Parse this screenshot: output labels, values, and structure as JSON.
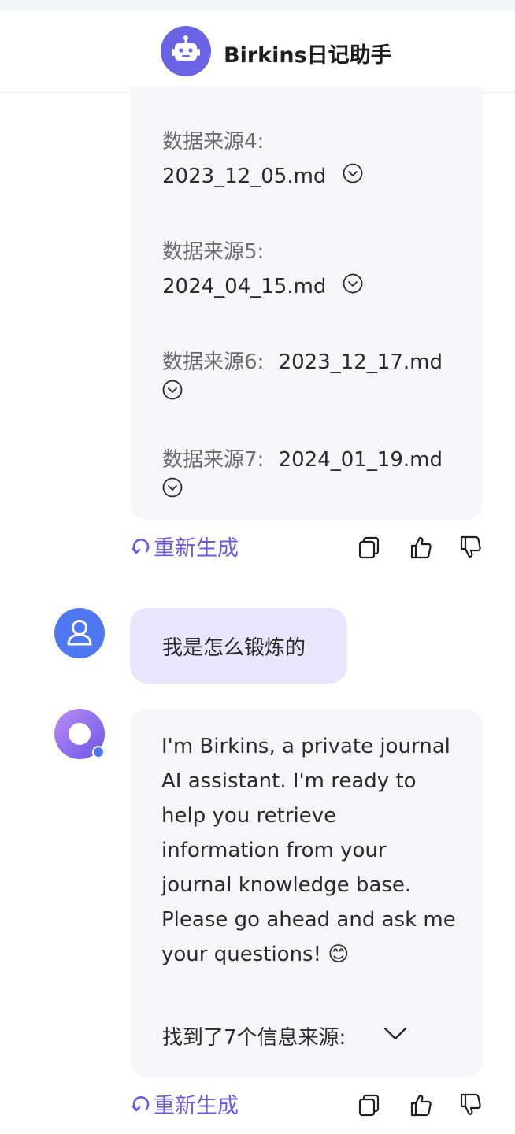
{
  "header": {
    "title": "Birkins日记助手"
  },
  "sources": [
    {
      "label": "数据来源4:",
      "file": "2023_12_05.md"
    },
    {
      "label": "数据来源5:",
      "file": "2024_04_15.md"
    },
    {
      "label": "数据来源6:",
      "file": "2023_12_17.md"
    },
    {
      "label": "数据来源7:",
      "file": "2024_01_19.md"
    }
  ],
  "actions": {
    "regenerate_label": "重新生成"
  },
  "user_message": {
    "text": "我是怎么锻炼的"
  },
  "bot_message": {
    "text": "I'm Birkins, a private journal AI assistant. I'm ready to help you retrieve information from your journal knowledge base. Please go ahead and ask me your questions! 😊",
    "found_label": "找到了7个信息来源:"
  },
  "colors": {
    "accent": "#6a58e8",
    "user_bubble": "#e9e5fd",
    "bot_bubble": "#f6f6f9",
    "user_avatar": "#4f77f2",
    "header_avatar": "#6a63e6"
  }
}
